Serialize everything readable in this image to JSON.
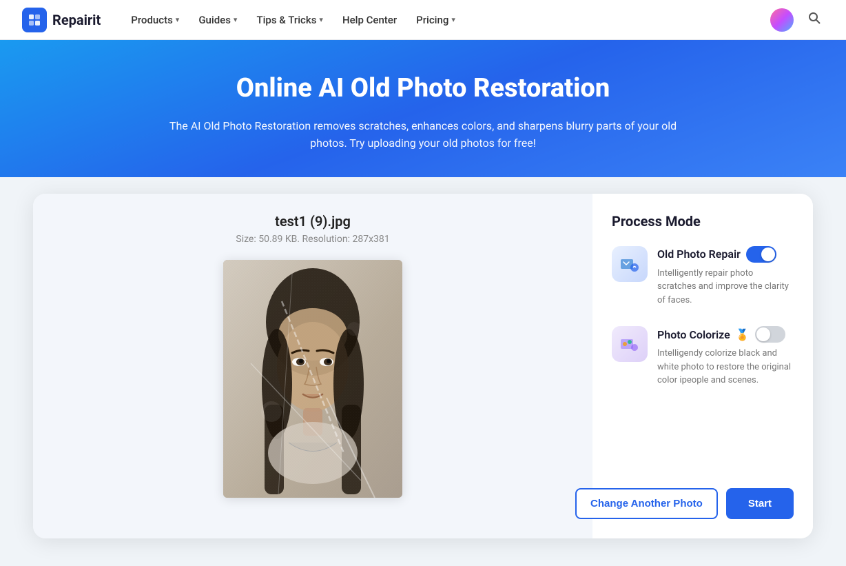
{
  "navbar": {
    "logo_icon": "R",
    "logo_text": "Repairit",
    "items": [
      {
        "label": "Products",
        "has_dropdown": true
      },
      {
        "label": "Guides",
        "has_dropdown": true
      },
      {
        "label": "Tips & Tricks",
        "has_dropdown": true
      },
      {
        "label": "Help Center",
        "has_dropdown": false
      },
      {
        "label": "Pricing",
        "has_dropdown": true
      }
    ]
  },
  "hero": {
    "title": "Online AI Old Photo Restoration",
    "subtitle": "The AI Old Photo Restoration removes scratches, enhances colors, and sharpens blurry parts of your old photos. Try uploading your old photos for free!"
  },
  "file": {
    "name": "test1 (9).jpg",
    "meta": "Size: 50.89 KB. Resolution: 287x381"
  },
  "process_mode": {
    "title": "Process Mode",
    "modes": [
      {
        "name": "Old Photo Repair",
        "emoji": "",
        "description": "Intelligently repair photo scratches and improve the clarity of faces.",
        "enabled": true,
        "icon": "🔧"
      },
      {
        "name": "Photo Colorize",
        "emoji": "🏅",
        "description": "Intelligendy colorize black and white photo to restore the original color ipeople and scenes.",
        "enabled": false,
        "icon": "🎨"
      }
    ]
  },
  "buttons": {
    "change_photo": "Change Another Photo",
    "start": "Start"
  }
}
